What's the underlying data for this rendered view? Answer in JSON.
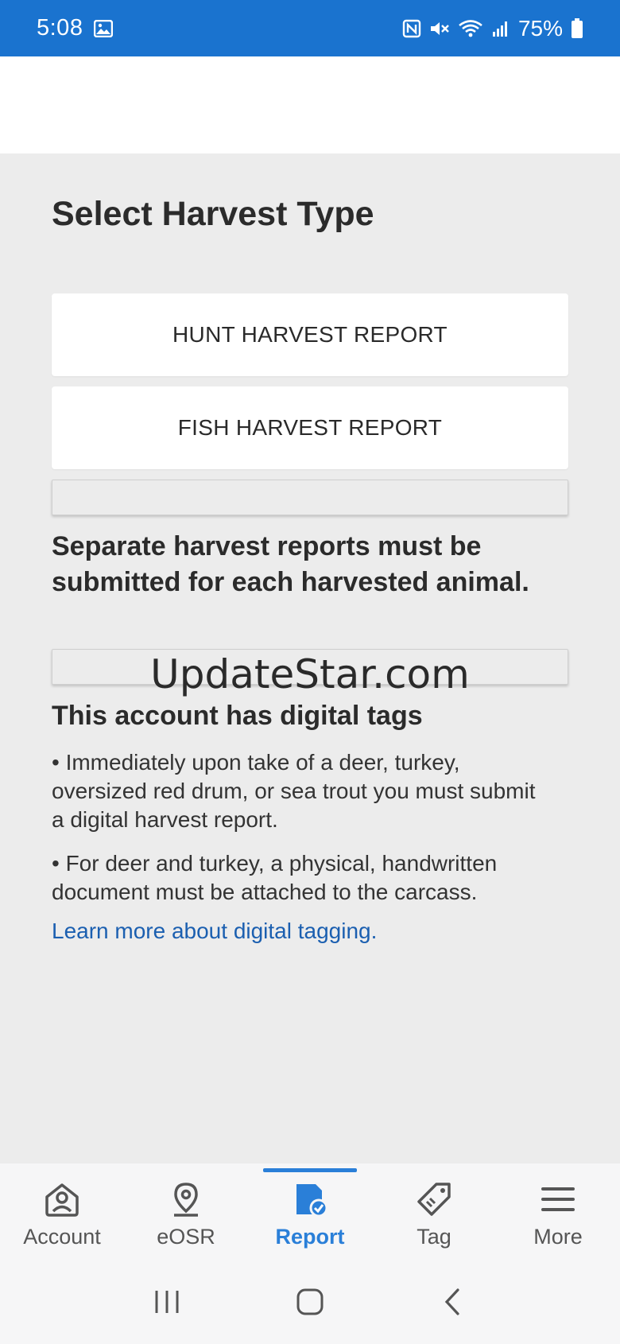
{
  "status_bar": {
    "time": "5:08",
    "battery": "75%",
    "icons": [
      "image-icon",
      "nfc-icon",
      "mute-icon",
      "wifi-icon",
      "signal-icon",
      "battery-icon"
    ],
    "background_color": "#1a73cf"
  },
  "main": {
    "title": "Select Harvest Type",
    "buttons": [
      {
        "label": "HUNT HARVEST REPORT"
      },
      {
        "label": "FISH HARVEST REPORT"
      }
    ],
    "notice": "Separate harvest reports must be submitted for each harvested animal.",
    "watermark": "UpdateStar.com",
    "digital_tags": {
      "heading": "This account has digital tags",
      "bullets": [
        "• Immediately upon take of a deer, turkey, oversized red drum, or sea trout you must submit a digital harvest report.",
        "• For deer and turkey, a physical, handwritten document must be attached to the carcass."
      ],
      "link": "Learn more about digital tagging."
    }
  },
  "bottom_nav": {
    "items": [
      {
        "label": "Account",
        "icon": "account-icon"
      },
      {
        "label": "eOSR",
        "icon": "location-pin-icon"
      },
      {
        "label": "Report",
        "icon": "report-icon",
        "active": true
      },
      {
        "label": "Tag",
        "icon": "tag-icon"
      },
      {
        "label": "More",
        "icon": "menu-icon"
      }
    ],
    "active_color": "#2a7fd8"
  },
  "system_nav": {
    "icons": [
      "recents-icon",
      "home-icon",
      "back-icon"
    ]
  }
}
